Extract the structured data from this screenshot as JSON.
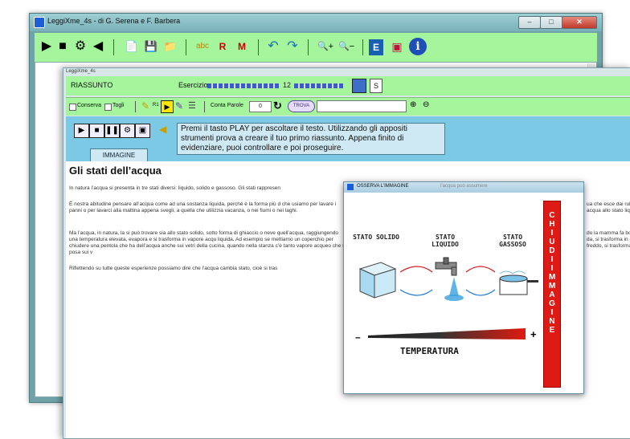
{
  "back_window": {
    "title": "LeggiXme_4s - di G. Serena e F. Barbera",
    "controls": [
      "–",
      "□",
      "✕"
    ],
    "toolbar": [
      "▶",
      "■",
      "⚙",
      "◀",
      "📄",
      "💾",
      "📁",
      "abc",
      "R",
      "M",
      "↶",
      "↷",
      "🔍+",
      "🔍−",
      "E",
      "▣",
      "i"
    ]
  },
  "front_window": {
    "title": "LeggiXme_4s",
    "riassunto": "RIASSUNTO",
    "esercizio_label": "Esercizio",
    "esercizio_num": "12",
    "s_label": "S",
    "conserva": "Conserva",
    "togli": "Togli",
    "r1": "R1",
    "conta_parole": "Conta Parole",
    "conta_value": "0",
    "trova": "TROVA",
    "message": "Premi il tasto PLAY per ascoltare il testo. Utilizzando gli appositi strumenti prova a creare il tuo primo riassunto. Appena finito di evidenziare, puoi controllare e poi proseguire.",
    "immagine_button": "IMMAGINE",
    "heading": "Gli stati dell’acqua",
    "paragraphs": [
      "In natura l’acqua si presenta in tre stati diversi: liquido, solido e gassoso. Gli stati rappresen",
      "È nostra abitudine pensare all’acqua come ad una sostanza liquida, perché è la forma più d che usiamo per lavare i panni o per lavarci alla mattina appena svegli, a quella che utilizzia vacanza, o nei fiumi o nei laghi.",
      "Ma l’acqua, in natura, la si può trovare sia allo stato solido, sotto forma di ghiaccio o neve quell’acqua, raggiungendo una temperatura elevata, evapora e si trasforma in vapore acqu liquida. Ad esempio se mettiamo un coperchio per chiudere una pentola che ha dell’acqua anche sui vetri della cucina, quando nella stanza c’è tanto vapore acqueo che si posa sui v",
      "Riflettendo su tutte queste esperienze possiamo dire che l’acqua cambia stato, cioè si tras"
    ],
    "right_snippets": [
      "ua che esce dai rubi",
      "acqua allo stato liq",
      "do la mamma fa bo",
      "da, si trasforma in c",
      "freddo, si trasforma"
    ]
  },
  "popup": {
    "title": "OSSERVA L’IMMAGINE",
    "behind_text": "l’acqua può assumere",
    "states": [
      "STATO SOLIDO",
      "STATO LIQUIDO",
      "STATO GASSOSO"
    ],
    "minus": "–",
    "plus": "+",
    "temperature": "TEMPERATURA",
    "chiudi": "CHIUDI IMMAGINE"
  }
}
